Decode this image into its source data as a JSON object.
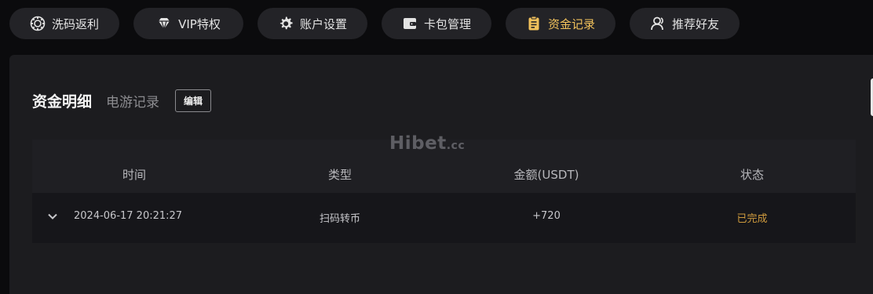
{
  "tabs": [
    {
      "label": "洗码返利",
      "icon": "chip-icon",
      "active": false
    },
    {
      "label": "VIP特权",
      "icon": "diamond-icon",
      "active": false
    },
    {
      "label": "账户设置",
      "icon": "gear-icon",
      "active": false
    },
    {
      "label": "卡包管理",
      "icon": "wallet-icon",
      "active": false
    },
    {
      "label": "资金记录",
      "icon": "clipboard-icon",
      "active": true
    },
    {
      "label": "推荐好友",
      "icon": "user-icon",
      "active": false
    }
  ],
  "panel": {
    "title": "资金明细",
    "subtitle": "电游记录",
    "edit_label": "编辑",
    "watermark": "Hibet",
    "watermark_suffix": ".cc",
    "columns": [
      "时间",
      "类型",
      "金额(USDT)",
      "状态"
    ],
    "rows": [
      {
        "time": "2024-06-17 20:21:27",
        "type": "扫码转币",
        "amount": "+720",
        "status": "已完成"
      }
    ]
  },
  "colors": {
    "accent": "#f1c15b",
    "status_done": "#cf9b3d",
    "panel_bg": "#1c1c1f",
    "page_bg": "#0b0b0d"
  }
}
